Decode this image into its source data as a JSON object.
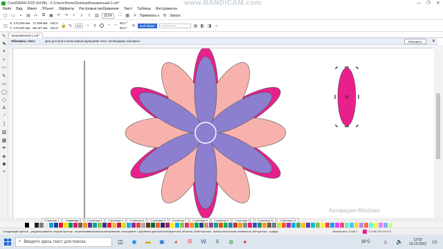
{
  "window": {
    "title": "CorelDRAW 2022 (64-Bit) - C:\\Users\\Home\\Desktop\\Безымянный-1.cdr*",
    "watermark": "www.BANDICAM.com",
    "controls": [
      "—",
      "❐",
      "✕"
    ]
  },
  "menu": [
    "Файл",
    "Вид",
    "Макет",
    "Объект",
    "Эффекты",
    "Растровые изображения",
    "Текст",
    "Таблица",
    "Инструменты"
  ],
  "toolbar": {
    "zoom": "111%",
    "snap_label": "Привязать к",
    "launch_label": "Запуск"
  },
  "propbar": {
    "x": "X: 170,848 мм",
    "y": "Y: 170,420 мм",
    "w": "17,939 мм",
    "h": "56,447 мм",
    "scale_x": "100,0",
    "scale_y": "100,0",
    "angle": "0,0",
    "angle_start": "90,0 °",
    "angle_end": "90,0 °",
    "fill_label": "ный абрис"
  },
  "doc_tab": "Безымянный-1.cdr*",
  "notification": {
    "title": "Обновить текст",
    "text": "Для доступа к всем новым функциям текст необходимо обновить.",
    "button": "Обновить"
  },
  "pages": [
    "Страница 1",
    "Страница 2",
    "Страница 3",
    "Страница 4",
    "Страница 5",
    "Страница 6",
    "Страница 7",
    "Страница 8",
    "Страница 9",
    "Страница 10",
    "Страница 11",
    "Страница 12"
  ],
  "palette": [
    "#000000",
    "#ffffff",
    "#1f1f1f",
    "#7f7f7f",
    "#e8e8e8",
    "#00a3e0",
    "#1f3d99",
    "#e31e24",
    "#ffdd00",
    "#009b48",
    "#ec008c",
    "#8b5a2b",
    "#f7931e",
    "#662d91",
    "#00a99d",
    "#8dc63f",
    "#2e3192",
    "#ed1c24",
    "#fbb040",
    "#be1e2d",
    "#d7df23",
    "#27aae1",
    "#92278f",
    "#ef4136",
    "#a7a9ac",
    "#603913",
    "#006838",
    "#f15a29",
    "#262262",
    "#9e1f63",
    "#fff200",
    "#00aeef",
    "#8cc63f",
    "#ee2a7b",
    "#f7941d",
    "#00a651",
    "#2b3990",
    "#c49a6c",
    "#8e44ad",
    "#16a085",
    "#d35400",
    "#27ae60",
    "#2980b9",
    "#c0392b",
    "#f39c12",
    "#7f8c8d",
    "#e91e63",
    "#3f51b5",
    "#009688",
    "#ff9800",
    "#795548",
    "#607d8b",
    "#cddc39",
    "#ff5722",
    "#9c27b0",
    "#03a9f4",
    "#4caf50",
    "#ffc107",
    "#673ab7",
    "#00bcd4",
    "#8bc34a",
    "#ffeb3b",
    "#f44336",
    "#2196f3",
    "#e040fb",
    "#ff4081",
    "#69f0ae",
    "#40c4ff",
    "#ffd740",
    "#b388ff",
    "#ff6e40",
    "#64ffda",
    "#eeff41",
    "#ea80fc",
    "#82b1ff",
    "#ccff90"
  ],
  "status": {
    "hint": "Следующий щелчок - редактирование; второй щелчок - перетаскивание/масштабирование; инструмент с двойным щелчком выбирает все объекты; Shift+щелчок - выбор нескольких элементов; Alt+щелчок - цифры",
    "object": "Эллипс вкл. Слой 1",
    "color": "C:0 M:100 Y:0 K:0"
  },
  "activation": "Активация Windows",
  "taskbar": {
    "search_placeholder": "Введите здесь текст для поиска",
    "temperature": "16°C",
    "time": "12:53",
    "date": "19.10.2022"
  },
  "colors": {
    "petal_dark": "#e8208c",
    "petal_pink": "#f7b2ad",
    "petal_purple": "#8d7fcf",
    "center": "#8d7fcf",
    "selection": "#e8208c"
  }
}
